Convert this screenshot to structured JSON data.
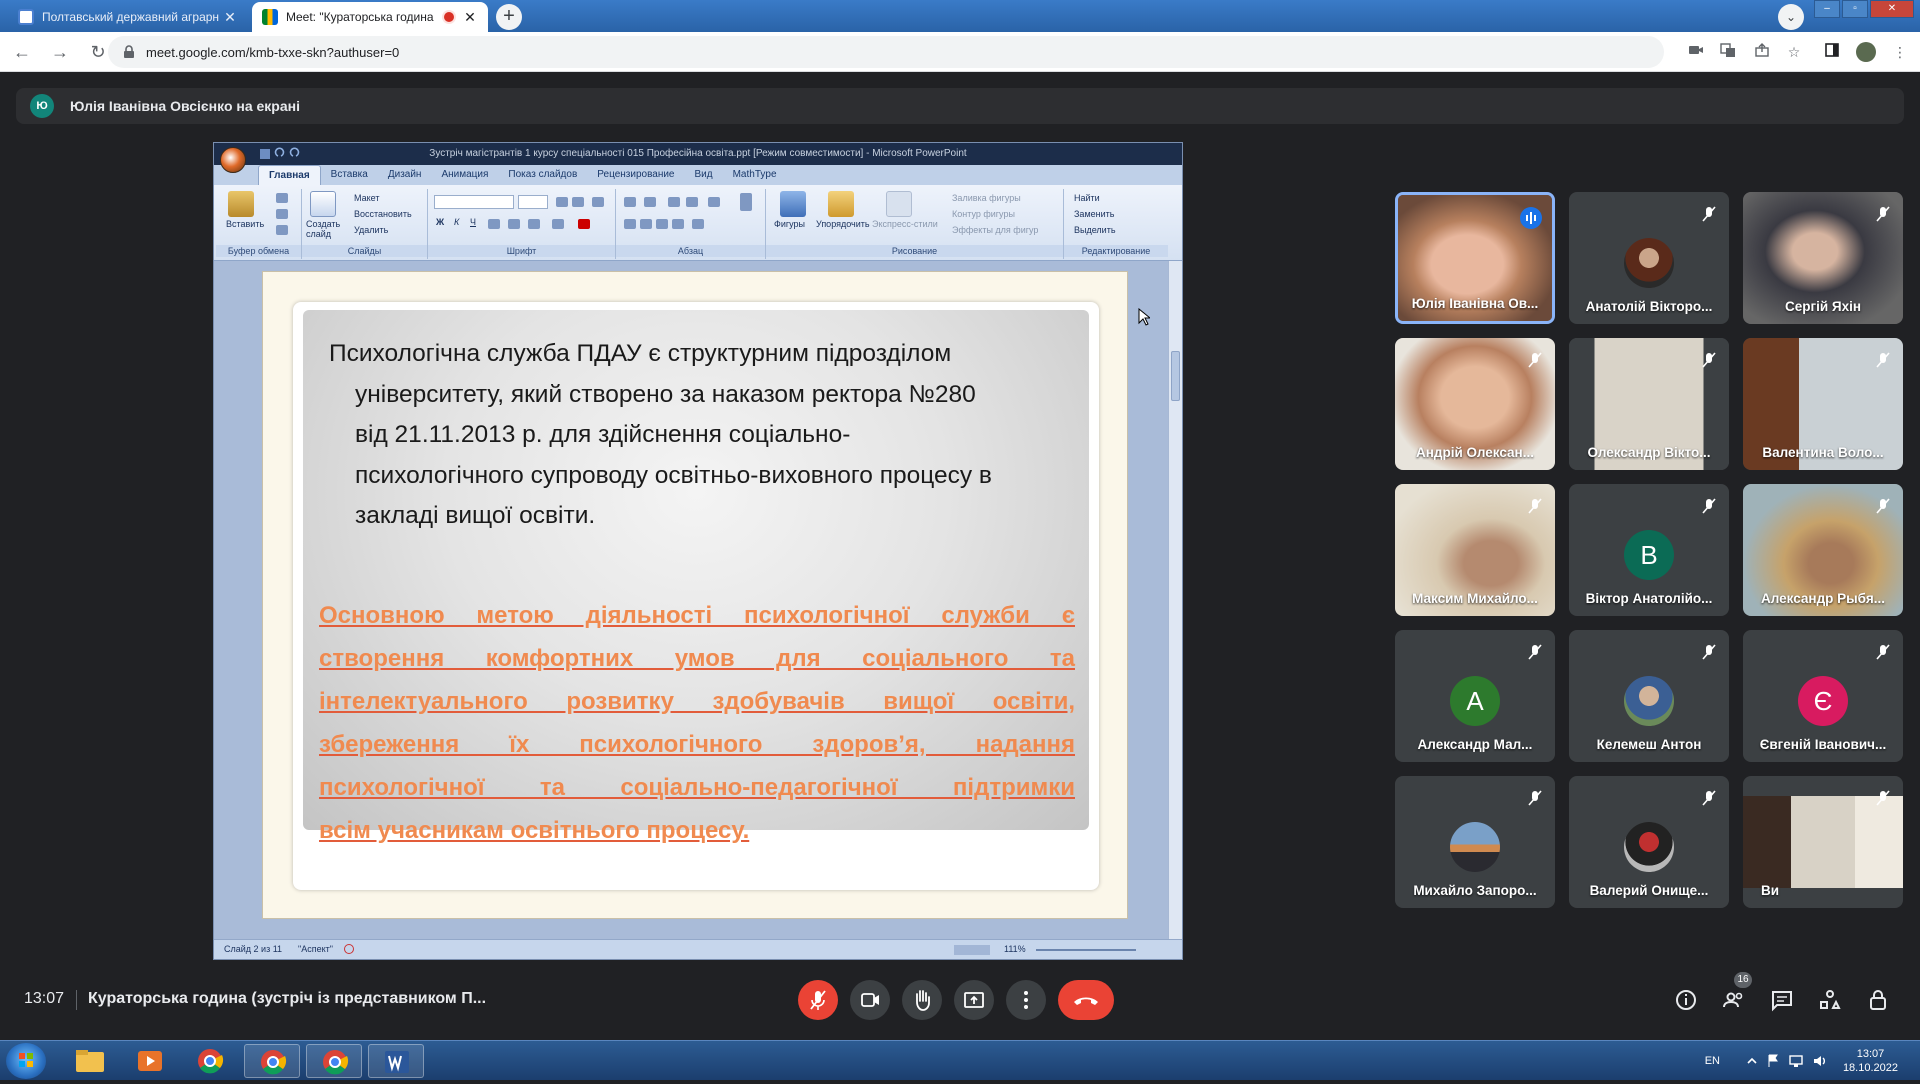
{
  "browser": {
    "tabs": [
      {
        "title": "Полтавський державний аграрн",
        "active": false
      },
      {
        "title": "Meet: \"Кураторська година",
        "active": true
      }
    ],
    "url": "meet.google.com/kmb-txxe-skn?authuser=0"
  },
  "meet": {
    "presenter_avatar": "Ю",
    "presenter_banner": "Юлія Іванівна Овсієнко на екрані",
    "time": "13:07",
    "meeting_title": "Кураторська година (зустріч із представником П...",
    "participant_count": "16",
    "participants": [
      {
        "name": "Юлія Іванівна Ов...",
        "speaking": true
      },
      {
        "name": "Анатолій Вікторо...",
        "muted": true
      },
      {
        "name": "Сергій Яхін",
        "muted": true
      },
      {
        "name": "Андрій Олексан...",
        "muted": true
      },
      {
        "name": "Олександр Вікто...",
        "muted": true
      },
      {
        "name": "Валентина Воло...",
        "muted": true
      },
      {
        "name": "Максим Михайло...",
        "muted": true
      },
      {
        "name": "Віктор Анатолійо...",
        "muted": true,
        "letter": "В",
        "color": "#0b6b55"
      },
      {
        "name": "Александр Рыбя...",
        "muted": true
      },
      {
        "name": "Александр Мал...",
        "muted": true,
        "letter": "А",
        "color": "#2d7a2d"
      },
      {
        "name": "Келемеш Антон",
        "muted": true
      },
      {
        "name": "Євгеній Іванович...",
        "muted": true,
        "letter": "Є",
        "color": "#d81b60"
      },
      {
        "name": "Михайло Запоро...",
        "muted": true
      },
      {
        "name": "Валерий Онище...",
        "muted": true
      },
      {
        "name": "Ви",
        "muted": true
      }
    ],
    "colors": {
      "accent": "#8ab4f8",
      "end_call": "#ea4335"
    }
  },
  "powerpoint": {
    "title": "Зустріч магістрантів 1 курсу спеціальності 015 Професійна освіта.ppt [Режим совместимости] - Microsoft PowerPoint",
    "tabs": [
      "Главная",
      "Вставка",
      "Дизайн",
      "Анимация",
      "Показ слайдов",
      "Рецензирование",
      "Вид",
      "MathType"
    ],
    "groups": {
      "clipboard": "Буфер обмена",
      "slides": "Слайды",
      "font": "Шрифт",
      "paragraph": "Абзац",
      "drawing": "Рисование",
      "editing": "Редактирование"
    },
    "buttons": {
      "paste": "Вставить",
      "new_slide": "Создать слайд",
      "layout": "Макет",
      "reset": "Восстановить",
      "delete": "Удалить",
      "shapes": "Фигуры",
      "arrange": "Упорядочить",
      "quick_styles": "Экспресс-стили",
      "fill": "Заливка фигуры",
      "outline": "Контур фигуры",
      "effects": "Эффекты для фигур",
      "find": "Найти",
      "replace": "Заменить",
      "select": "Выделить"
    },
    "status": {
      "slide": "Слайд 2 из 11",
      "theme": "\"Аспект\"",
      "zoom": "111%"
    },
    "slide": {
      "para1_lines": [
        "Психологічна служба ПДАУ є структурним підрозділом",
        "університету, який створено за наказом ректора №280",
        "від 21.11.2013 р. для здійснення соціально-",
        "психологічного супроводу освітньо-виховного процесу в",
        "закладі вищої освіти."
      ],
      "para2_lines": [
        "Основною метою діяльності психологічної служби є",
        "створення комфортних умов для соціального та",
        "інтелектуального розвитку здобувачів вищої освіти,",
        "збереження їх психологічного здоров’я, надання",
        "психологічної та соціально-педагогічної підтримки",
        "всім учасникам освітнього процесу."
      ]
    }
  },
  "taskbar": {
    "lang": "EN",
    "time": "13:07",
    "date": "18.10.2022"
  }
}
